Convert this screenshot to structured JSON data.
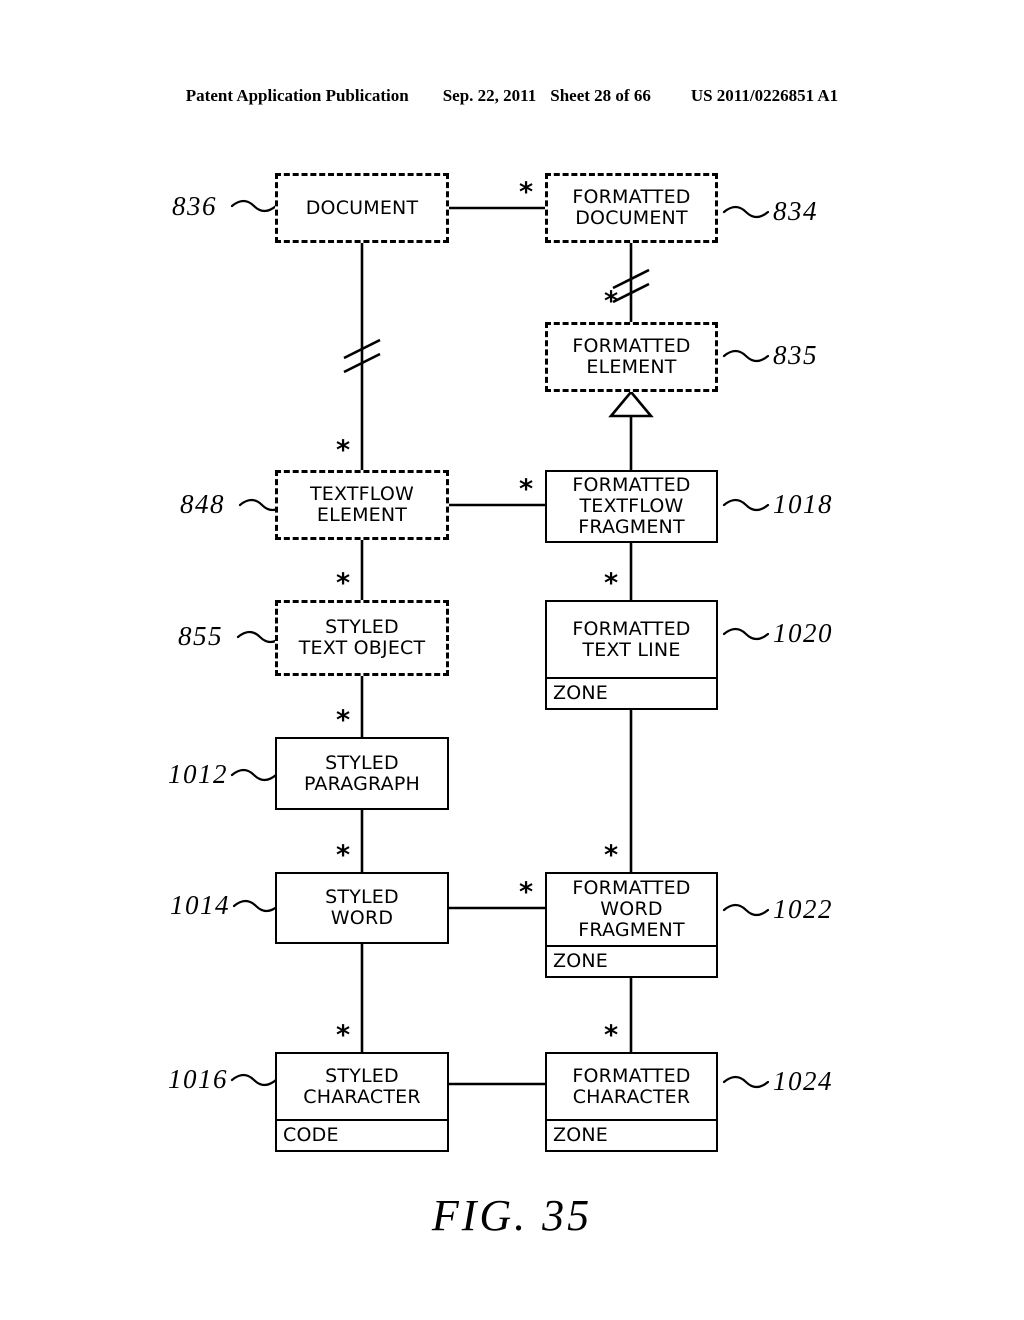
{
  "header": {
    "publication": "Patent Application Publication",
    "date": "Sep. 22, 2011",
    "sheet": "Sheet 28 of 66",
    "number": "US 2011/0226851 A1"
  },
  "figure": {
    "caption": "FIG. 35"
  },
  "diagram": {
    "type": "uml-class-diagram",
    "multiplicity_symbol": "*",
    "nodes": [
      {
        "id": "document",
        "title": "DOCUMENT",
        "ref": "836",
        "ref_side": "left",
        "style": "dashed",
        "compartment": null
      },
      {
        "id": "formatted-document",
        "title": "FORMATTED\nDOCUMENT",
        "ref": "834",
        "ref_side": "right",
        "style": "dashed",
        "compartment": null
      },
      {
        "id": "formatted-element",
        "title": "FORMATTED\nELEMENT",
        "ref": "835",
        "ref_side": "right",
        "style": "dashed",
        "compartment": null
      },
      {
        "id": "textflow-element",
        "title": "TEXTFLOW\nELEMENT",
        "ref": "848",
        "ref_side": "left",
        "style": "dashed",
        "compartment": null
      },
      {
        "id": "formatted-textflow-fragment",
        "title": "FORMATTED\nTEXTFLOW\nFRAGMENT",
        "ref": "1018",
        "ref_side": "right",
        "style": "solid",
        "compartment": null
      },
      {
        "id": "styled-text-object",
        "title": "STYLED\nTEXT OBJECT",
        "ref": "855",
        "ref_side": "left",
        "style": "dashed",
        "compartment": null
      },
      {
        "id": "formatted-text-line",
        "title": "FORMATTED\nTEXT LINE",
        "ref": "1020",
        "ref_side": "right",
        "style": "solid",
        "compartment": "ZONE"
      },
      {
        "id": "styled-paragraph",
        "title": "STYLED\nPARAGRAPH",
        "ref": "1012",
        "ref_side": "left",
        "style": "solid",
        "compartment": null
      },
      {
        "id": "styled-word",
        "title": "STYLED\nWORD",
        "ref": "1014",
        "ref_side": "left",
        "style": "solid",
        "compartment": null
      },
      {
        "id": "formatted-word-fragment",
        "title": "FORMATTED\nWORD\nFRAGMENT",
        "ref": "1022",
        "ref_side": "right",
        "style": "solid",
        "compartment": "ZONE"
      },
      {
        "id": "styled-character",
        "title": "STYLED\nCHARACTER",
        "ref": "1016",
        "ref_side": "left",
        "style": "solid",
        "compartment": "CODE"
      },
      {
        "id": "formatted-character",
        "title": "FORMATTED\nCHARACTER",
        "ref": "1024",
        "ref_side": "right",
        "style": "solid",
        "compartment": "ZONE"
      }
    ]
  }
}
